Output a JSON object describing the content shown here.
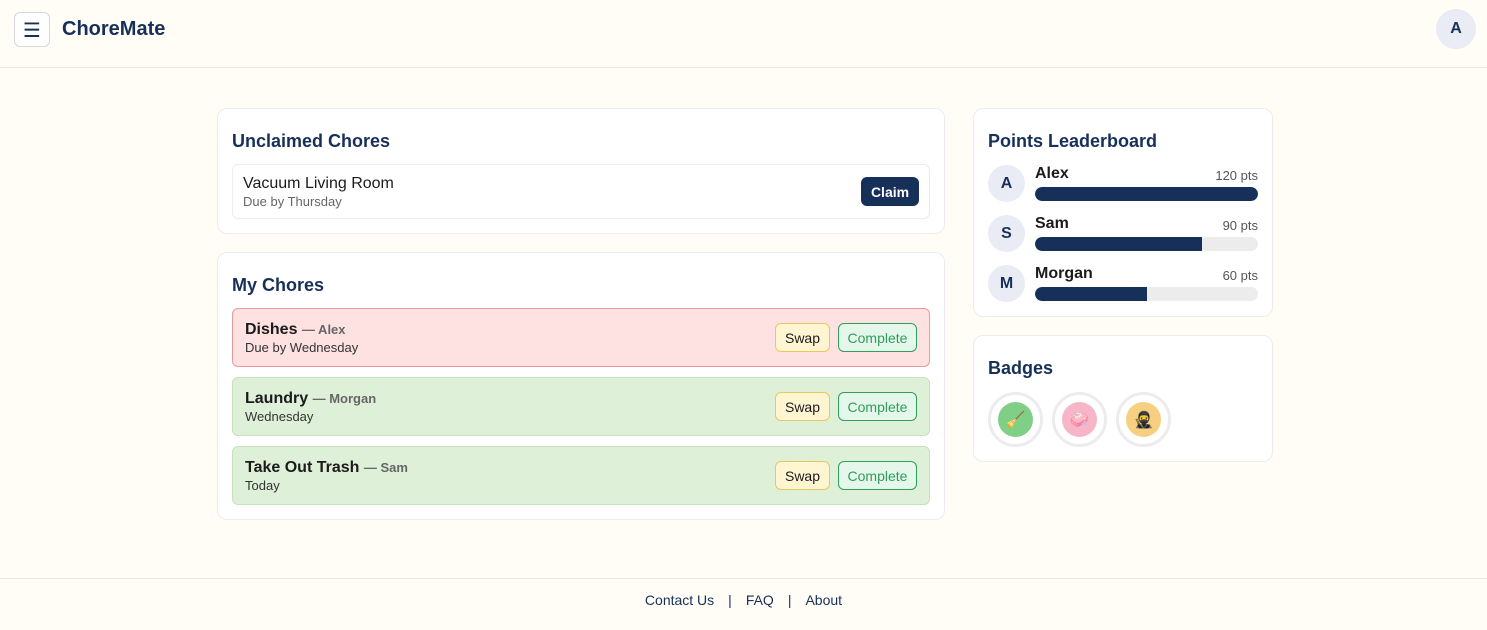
{
  "header": {
    "menu_icon": "☰",
    "app_title": "ChoreMate",
    "user_initial": "A"
  },
  "unclaimed": {
    "title": "Unclaimed Chores",
    "items": [
      {
        "name": "Vacuum Living Room",
        "due": "Due by Thursday",
        "action_label": "Claim"
      }
    ]
  },
  "my_chores": {
    "title": "My Chores",
    "items": [
      {
        "name": "Dishes",
        "assignee": "— Alex",
        "due": "Due by Wednesday",
        "status": "overdue",
        "swap_label": "Swap",
        "complete_label": "Complete"
      },
      {
        "name": "Laundry",
        "assignee": "— Morgan",
        "due": "Wednesday",
        "status": "ok",
        "swap_label": "Swap",
        "complete_label": "Complete"
      },
      {
        "name": "Take Out Trash",
        "assignee": "— Sam",
        "due": "Today",
        "status": "ok",
        "swap_label": "Swap",
        "complete_label": "Complete"
      }
    ]
  },
  "leaderboard": {
    "title": "Points Leaderboard",
    "entries": [
      {
        "initial": "A",
        "name": "Alex",
        "points": "120 pts",
        "progress": 1.0
      },
      {
        "initial": "S",
        "name": "Sam",
        "points": "90 pts",
        "progress": 0.75
      },
      {
        "initial": "M",
        "name": "Morgan",
        "points": "60 pts",
        "progress": 0.5
      }
    ]
  },
  "badges": {
    "title": "Badges",
    "items": [
      {
        "icon": "broom-icon",
        "glyph": "🧹",
        "color": "#7fcf87"
      },
      {
        "icon": "sparkle-icon",
        "glyph": "🧼",
        "color": "#f7b6c8"
      },
      {
        "icon": "ninja-icon",
        "glyph": "🥷",
        "color": "#f6cf80"
      }
    ]
  },
  "footer": {
    "links": [
      "Contact Us",
      "FAQ",
      "About"
    ],
    "separator": "|"
  },
  "colors": {
    "primary": "#17305a",
    "page_bg": "#fffdf6",
    "overdue_bg": "#fee2e2",
    "ok_bg": "#dff0d8",
    "swap_bg": "#fff5d1",
    "complete_text": "#2e9e5b"
  }
}
